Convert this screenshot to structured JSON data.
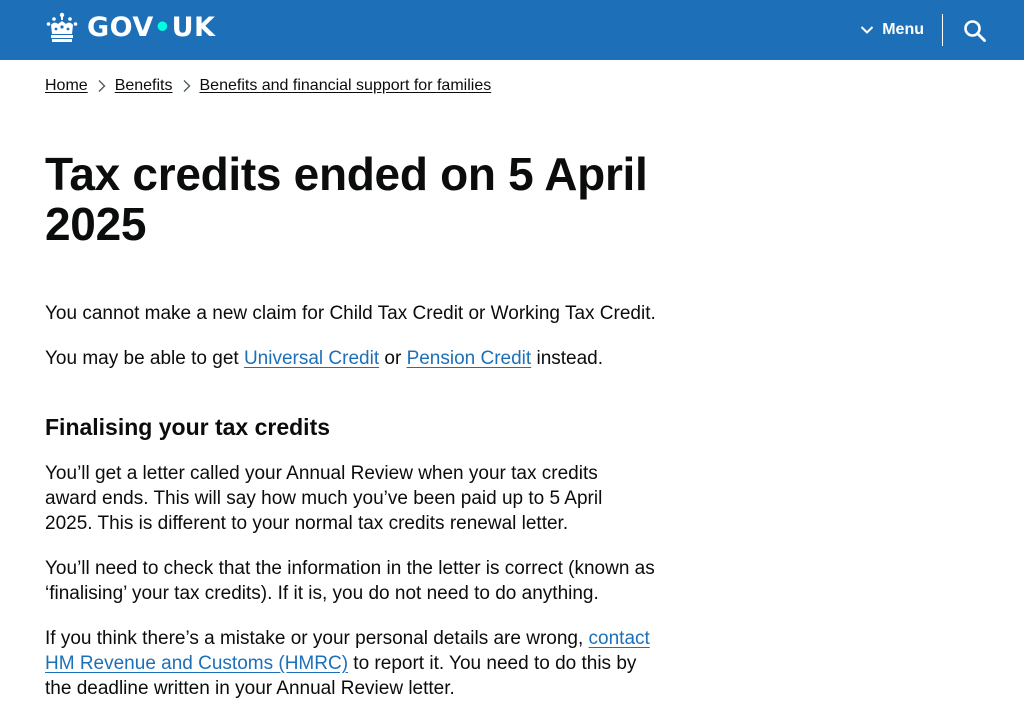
{
  "header": {
    "logo_main": "GOV",
    "logo_dot": "•",
    "logo_end": "UK",
    "menu_label": "Menu",
    "icons": {
      "logo": "crown-icon",
      "menu": "chevron-down-icon",
      "search": "search-icon"
    },
    "colors": {
      "background": "#1d70b8",
      "accent_dot": "#00ffe0"
    }
  },
  "breadcrumb": {
    "items": [
      {
        "label": "Home"
      },
      {
        "label": "Benefits"
      },
      {
        "label": "Benefits and financial support for families"
      }
    ]
  },
  "page": {
    "title": "Tax credits ended on 5 April 2025",
    "intro": "You cannot make a new claim for Child Tax Credit or Working Tax Credit.",
    "alt_prefix": "You may be able to get ",
    "alt_link1": "Universal Credit",
    "alt_mid": " or ",
    "alt_link2": "Pension Credit",
    "alt_suffix": " instead.",
    "section_heading": "Finalising your tax credits",
    "para1": "You’ll get a letter called your Annual Review when your tax credits award ends. This will say how much you’ve been paid up to 5 April 2025. This is different to your normal tax credits renewal letter.",
    "para2": "You’ll need to check that the information in the letter is correct (known as ‘finalising’ your tax credits). If it is, you do not need to do anything.",
    "para3_prefix": "If you think there’s a mistake or your personal details are wrong, ",
    "para3_link": "contact HM Revenue and Customs (HMRC)",
    "para3_suffix": " to report it. You need to do this by the deadline written in your Annual Review letter.",
    "link_color": "#1d70b8"
  }
}
